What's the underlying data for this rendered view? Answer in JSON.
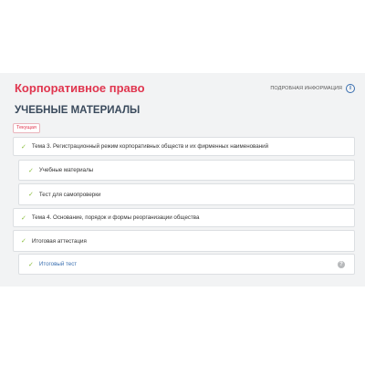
{
  "header": {
    "course_title": "Корпоративное право",
    "more_info_label": "ПОДРОБНАЯ ИНФОРМАЦИЯ",
    "info_icon_glyph": "i"
  },
  "section": {
    "title": "УЧЕБНЫЕ МАТЕРИАЛЫ",
    "current_badge": "Текущая"
  },
  "items": [
    {
      "label": "Тема 3. Регистрационный режим корпоративных обществ и их фирменных наименований",
      "check": "✓",
      "icon": "check-icon"
    },
    {
      "label": "Учебные материалы",
      "check": "✓",
      "icon": "check-icon"
    },
    {
      "label": "Тест для самопроверки",
      "check": "✓",
      "icon": "check-icon"
    },
    {
      "label": "Тема 4. Основание, порядок и формы реорганизации общества",
      "check": "✓",
      "icon": "check-icon"
    },
    {
      "label": "Итоговая аттестация",
      "check": "✓",
      "icon": "check-icon"
    },
    {
      "label": "Итоговый тест",
      "check": "✓",
      "icon": "check-icon",
      "help_glyph": "?"
    }
  ],
  "colors": {
    "accent_red": "#e0364f",
    "check_green": "#8cbf3f",
    "link_blue": "#3a6fb0"
  }
}
